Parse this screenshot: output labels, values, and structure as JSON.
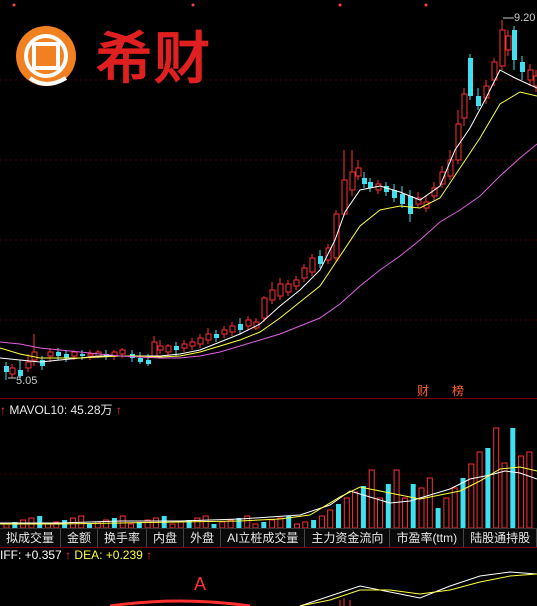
{
  "logo": {
    "text": "希财"
  },
  "price_chart": {
    "high_label": "9.20",
    "low_label": "5.05",
    "badges": [
      "财",
      "榜"
    ]
  },
  "volume": {
    "indicator_label": "MAVOL10:",
    "indicator_value": "45.28万"
  },
  "tabs": [
    "拟成交量",
    "金额",
    "换手率",
    "内盘",
    "外盘",
    "AI立桩成交量",
    "主力资金流向",
    "市盈率(ttm)",
    "陆股通持股"
  ],
  "macd": {
    "diff_label": "IFF:",
    "diff_value": "+0.357",
    "dea_label": "DEA:",
    "dea_value": "+0.239",
    "marker": "A"
  },
  "colors": {
    "up": "#ff3030",
    "down": "#40e0f0",
    "ma_white": "#ffffff",
    "ma_yellow": "#ffff40",
    "ma_pink": "#e060e0",
    "logo_red": "#e02020",
    "logo_orange": "#f08020"
  }
}
